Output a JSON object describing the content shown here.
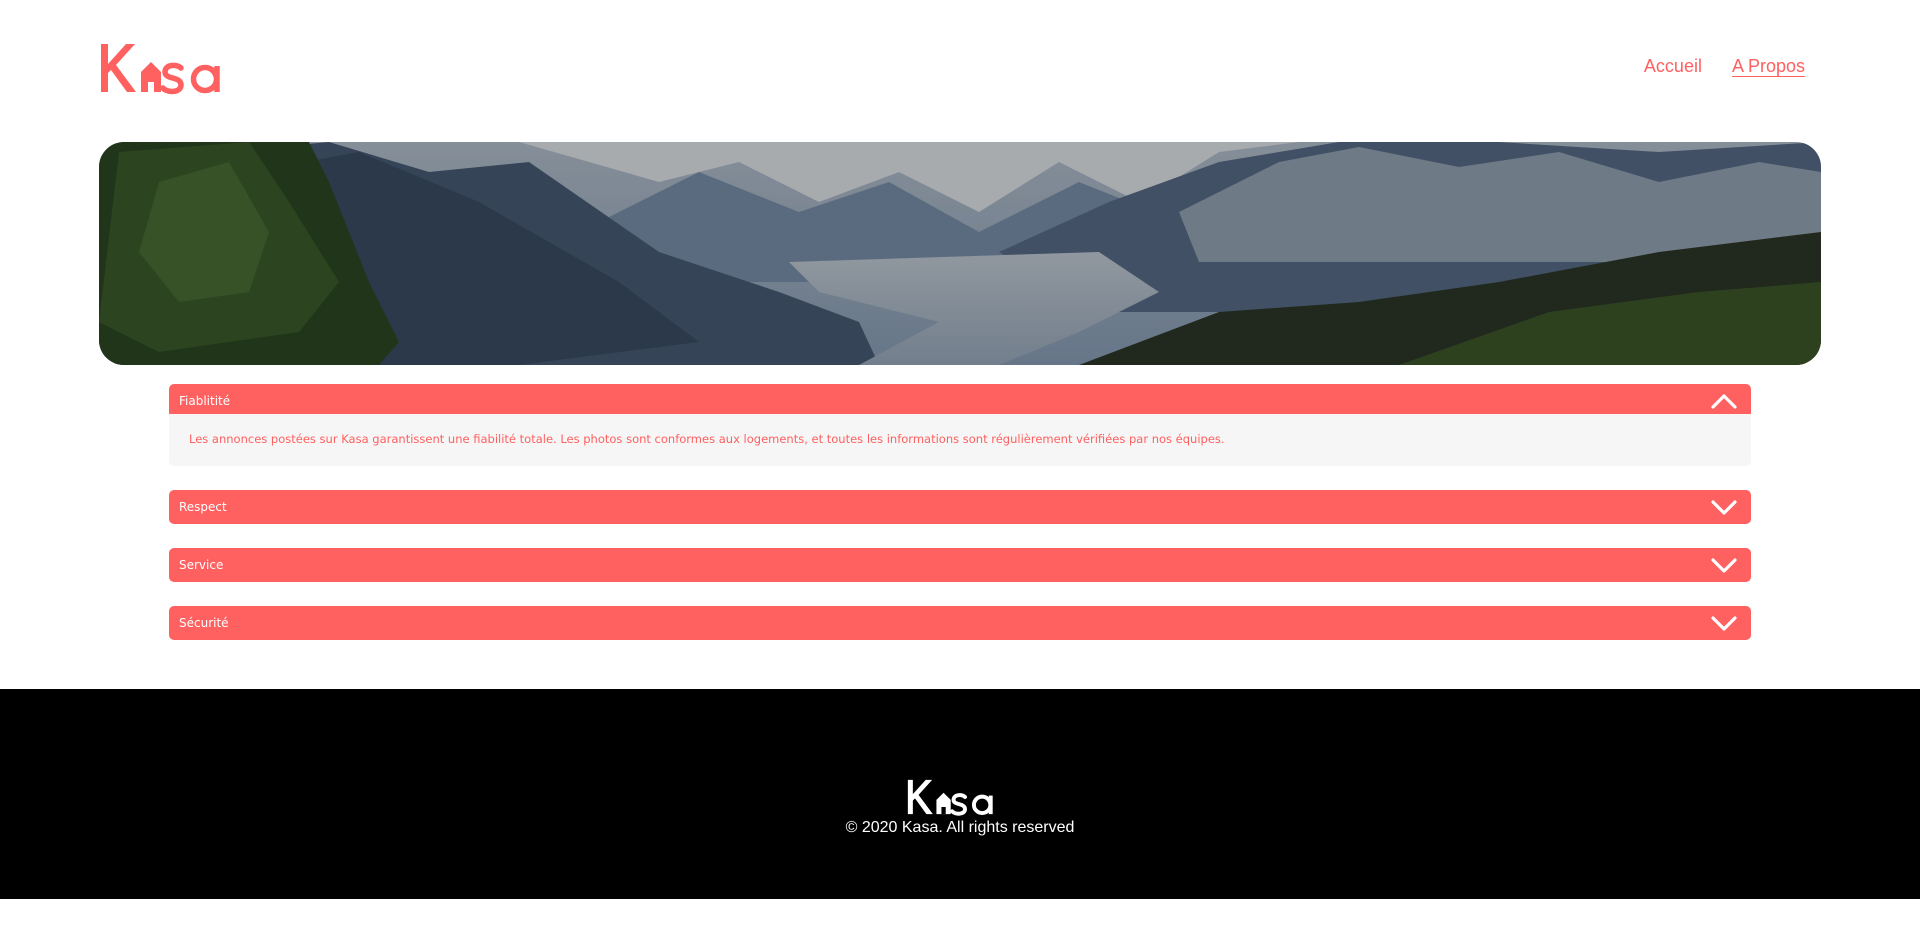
{
  "brand": {
    "name": "Kasa",
    "color": "#FF6060"
  },
  "nav": {
    "items": [
      {
        "label": "Accueil",
        "active": false
      },
      {
        "label": "A Propos",
        "active": true
      }
    ]
  },
  "collapses": [
    {
      "title": "Fiablitité",
      "expanded": true,
      "content": "Les annonces postées sur Kasa garantissent une fiabilité totale. Les photos sont conformes aux logements, et toutes les informations sont régulièrement vérifiées par nos équipes."
    },
    {
      "title": "Respect",
      "expanded": false
    },
    {
      "title": "Service",
      "expanded": false
    },
    {
      "title": "Sécurité",
      "expanded": false
    }
  ],
  "icons": {
    "expanded": "chevron-up-icon",
    "collapsed": "chevron-down-icon"
  },
  "footer": {
    "copyright": "© 2020 Kasa. All rights reserved"
  }
}
